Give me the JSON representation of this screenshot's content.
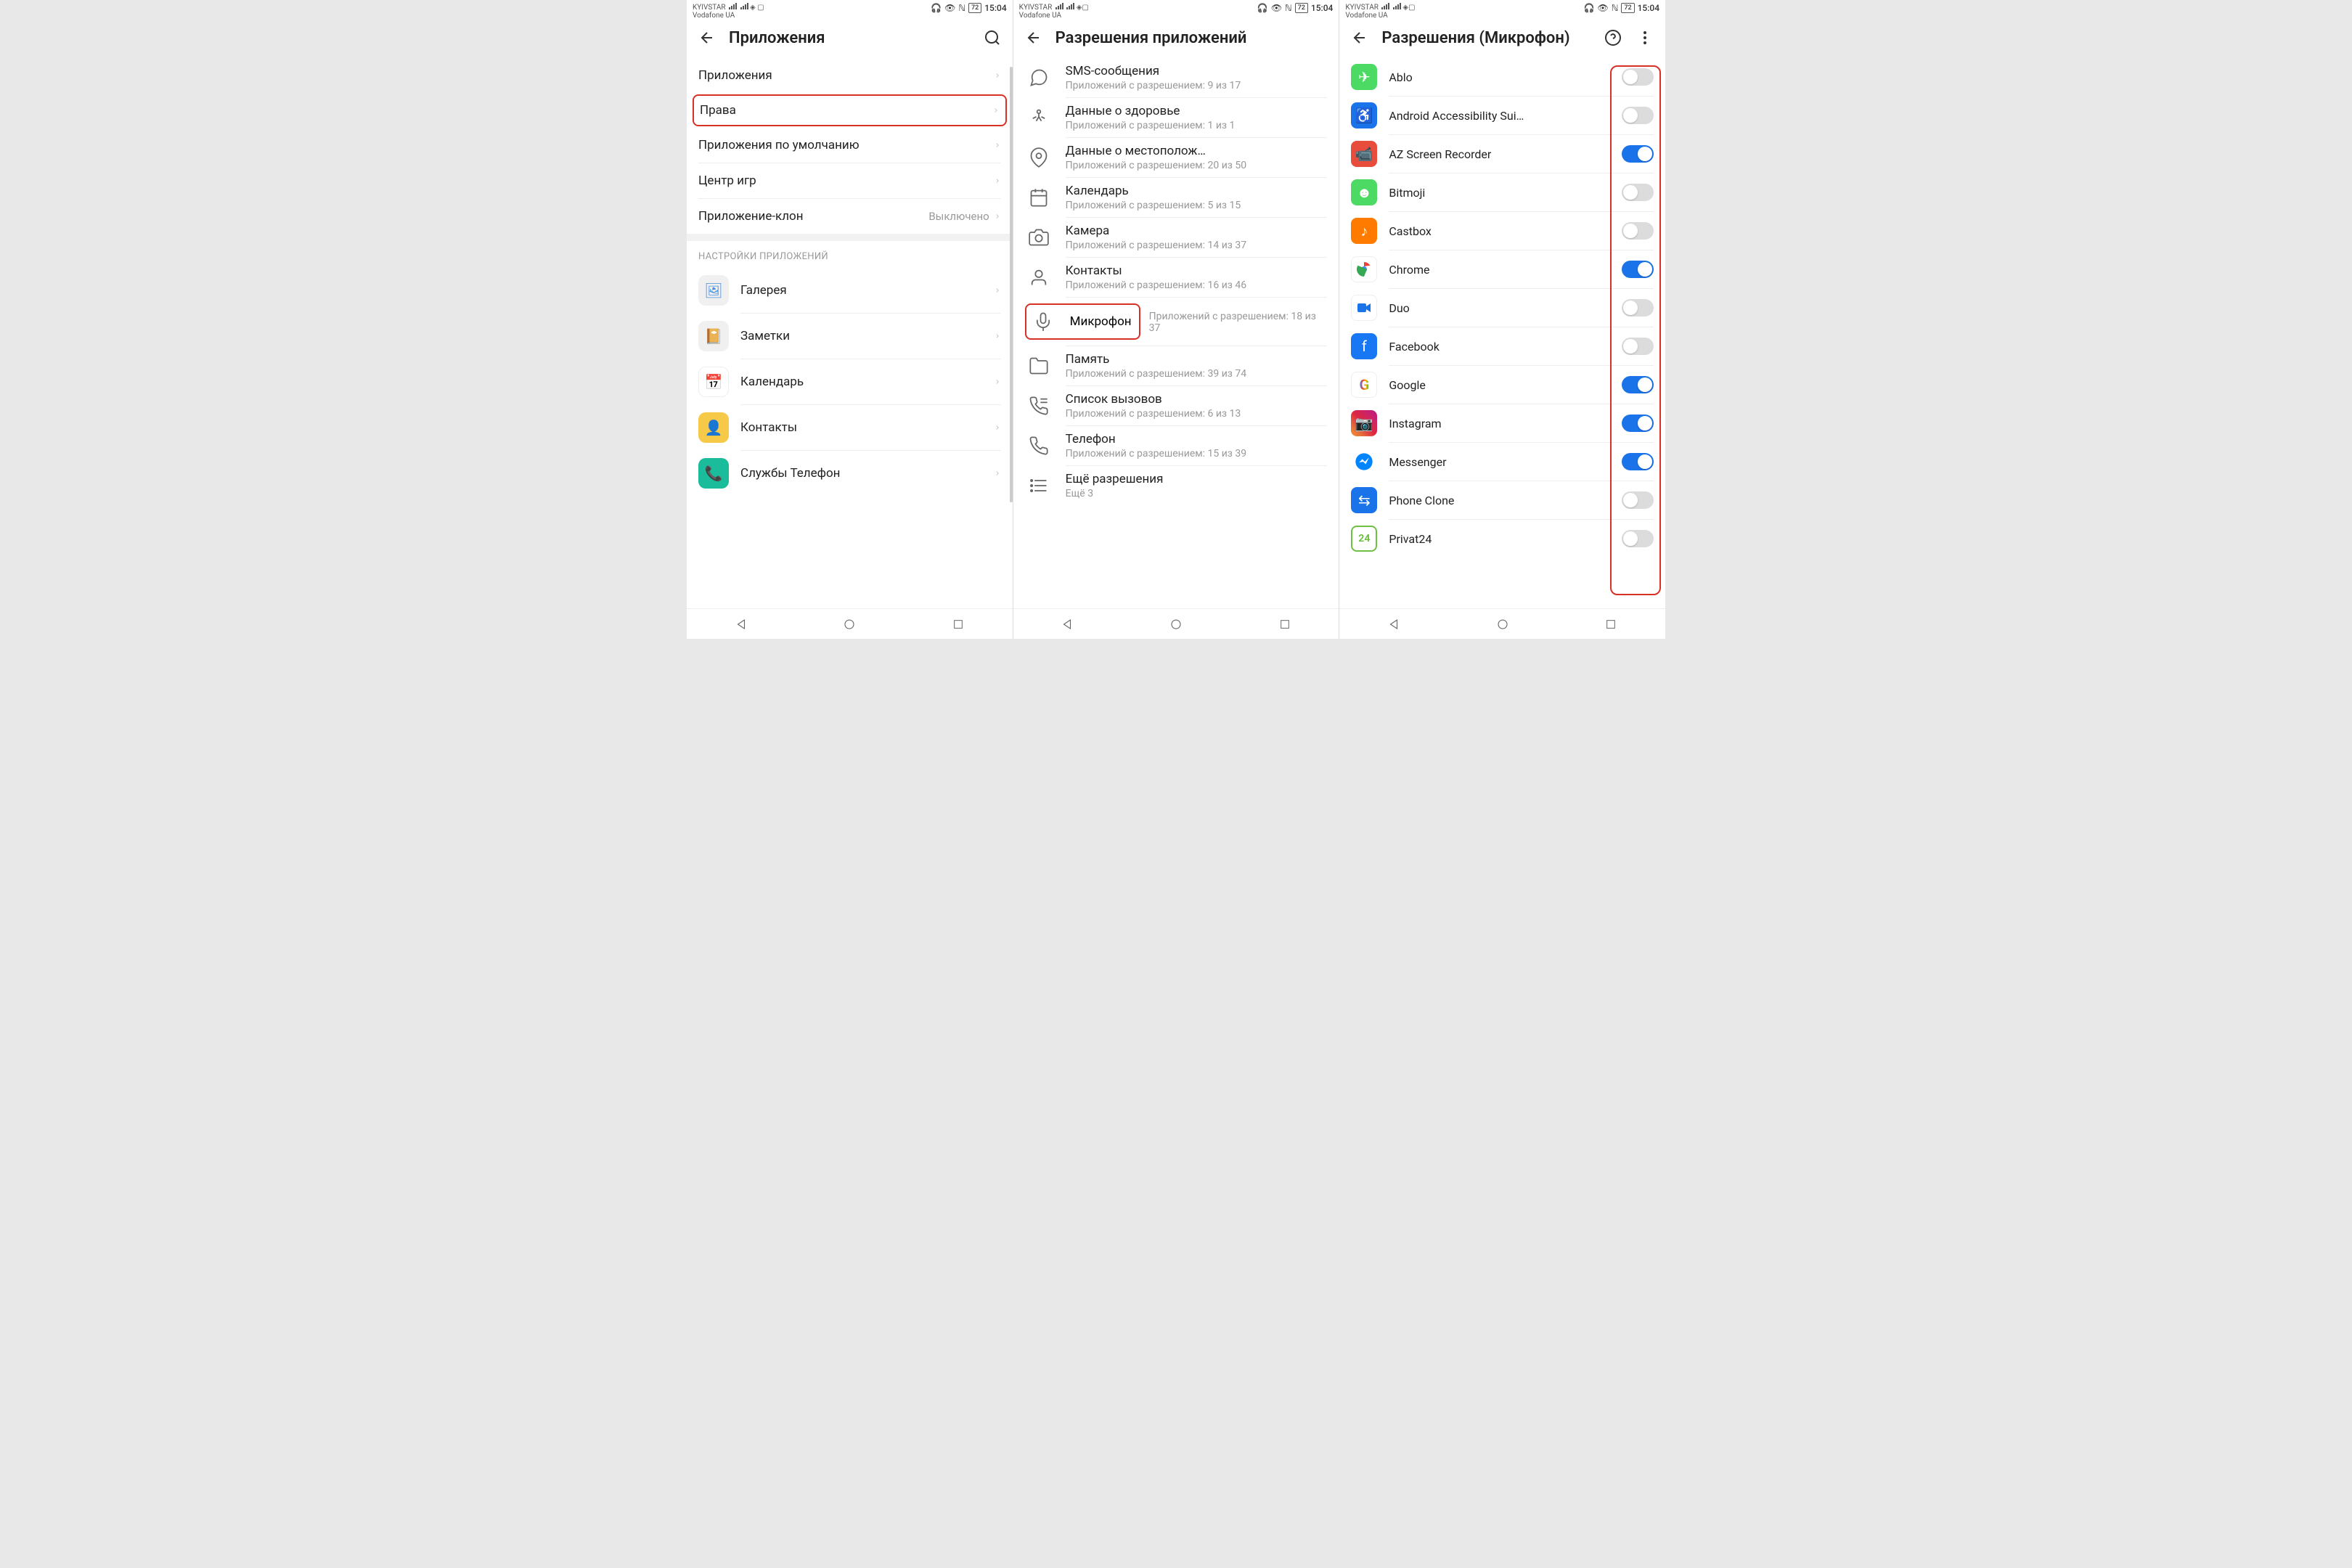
{
  "status": {
    "carrier1": "KYIVSTAR",
    "carrier2": "Vodafone UA",
    "battery": "72",
    "time": "15:04"
  },
  "screen1": {
    "title": "Приложения",
    "items": [
      {
        "label": "Приложения"
      },
      {
        "label": "Права",
        "highlight": true
      },
      {
        "label": "Приложения по умолчанию"
      },
      {
        "label": "Центр игр"
      },
      {
        "label": "Приложение-клон",
        "value": "Выключено"
      }
    ],
    "section_label": "НАСТРОЙКИ ПРИЛОЖЕНИЙ",
    "apps": [
      {
        "label": "Галерея",
        "icon": "gallery"
      },
      {
        "label": "Заметки",
        "icon": "notes"
      },
      {
        "label": "Календарь",
        "icon": "cal"
      },
      {
        "label": "Контакты",
        "icon": "contacts"
      },
      {
        "label": "Службы Телефон",
        "icon": "phone"
      }
    ]
  },
  "screen2": {
    "title": "Разрешения приложений",
    "perms": [
      {
        "label": "SMS-сообщения",
        "sub": "Приложений с разрешением: 9 из 17",
        "icon": "sms"
      },
      {
        "label": "Данные о здоровье",
        "sub": "Приложений с разрешением: 1 из 1",
        "icon": "health"
      },
      {
        "label": "Данные о местополож…",
        "sub": "Приложений с разрешением: 20 из 50",
        "icon": "location"
      },
      {
        "label": "Календарь",
        "sub": "Приложений с разрешением: 5 из 15",
        "icon": "calendar"
      },
      {
        "label": "Камера",
        "sub": "Приложений с разрешением: 14 из 37",
        "icon": "camera"
      },
      {
        "label": "Контакты",
        "sub": "Приложений с разрешением: 16 из 46",
        "icon": "contacts"
      },
      {
        "label": "Микрофон",
        "sub": "Приложений с разрешением: 18 из 37",
        "icon": "mic",
        "highlight": true
      },
      {
        "label": "Память",
        "sub": "Приложений с разрешением: 39 из 74",
        "icon": "storage"
      },
      {
        "label": "Список вызовов",
        "sub": "Приложений с разрешением: 6 из 13",
        "icon": "calllog"
      },
      {
        "label": "Телефон",
        "sub": "Приложений с разрешением: 15 из 39",
        "icon": "phone"
      }
    ],
    "more": "Ещё разрешения",
    "more_sub": "Ещё 3"
  },
  "screen3": {
    "title": "Разрешения (Микрофон)",
    "apps": [
      {
        "label": "Ablo",
        "icon": "ablo",
        "on": false
      },
      {
        "label": "Android Accessibility Sui…",
        "icon": "access",
        "on": false
      },
      {
        "label": "AZ Screen Recorder",
        "icon": "az",
        "on": true
      },
      {
        "label": "Bitmoji",
        "icon": "bitmoji",
        "on": false
      },
      {
        "label": "Castbox",
        "icon": "castbox",
        "on": false
      },
      {
        "label": "Chrome",
        "icon": "chrome",
        "on": true
      },
      {
        "label": "Duo",
        "icon": "duo",
        "on": false
      },
      {
        "label": "Facebook",
        "icon": "fb",
        "on": false
      },
      {
        "label": "Google",
        "icon": "google",
        "on": true
      },
      {
        "label": "Instagram",
        "icon": "ig",
        "on": true
      },
      {
        "label": "Messenger",
        "icon": "msg",
        "on": true
      },
      {
        "label": "Phone Clone",
        "icon": "pc",
        "on": false
      },
      {
        "label": "Privat24",
        "icon": "p24",
        "on": false
      }
    ]
  }
}
